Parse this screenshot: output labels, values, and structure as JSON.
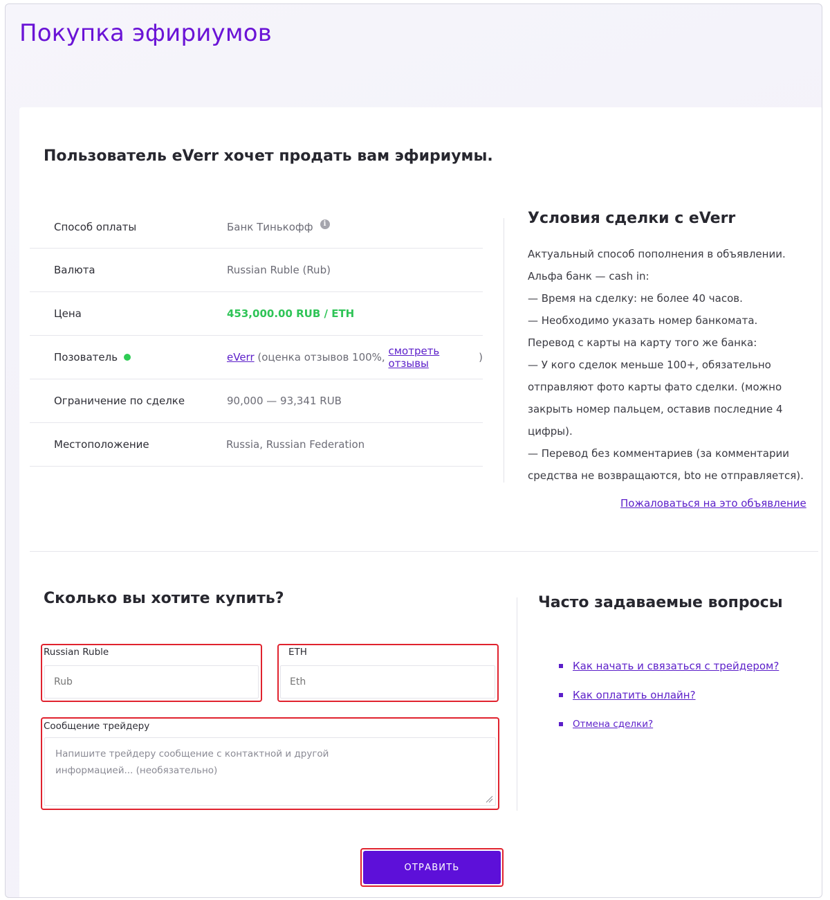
{
  "page_title": "Покупка эфириумов",
  "offer_heading": "Пользователь eVerr хочет продать вам эфириумы.",
  "details": {
    "payment_method_label": "Способ оплаты",
    "payment_method_value": "Банк Тинькофф",
    "currency_label": "Валюта",
    "currency_value": "Russian Ruble (Rub)",
    "price_label": "Цена",
    "price_value": "453,000.00 RUB / ETH",
    "user_label": "Позователь",
    "user_name": "eVerr",
    "user_rating_prefix": " (оценка отзывов 100%, ",
    "user_reviews_link": "смотреть отзывы",
    "user_rating_suffix": ")",
    "limit_label": "Ограничение по сделке",
    "limit_value": "90,000 — 93,341 RUB",
    "location_label": "Местоположение",
    "location_value": "Russia, Russian Federation"
  },
  "terms": {
    "heading": "Условия сделки с eVerr",
    "lines": [
      "Актуальный способ пополнения в объявлении.",
      "Альфа банк — cash in:",
      "— Время на сделку: не более 40 часов.",
      "— Необходимо указать номер банкомата.",
      "Перевод с карты на карту того же банка:",
      "— У кого сделок меньше 100+, обязательно отправляют фото карты фато сделки. (можно закрыть номер пальцем, оставив последние 4 цифры).",
      "— Перевод без комментариев (за комментарии средства не возвращаются, bto не отправляется)."
    ],
    "report_link": "Пожаловаться на это объявление"
  },
  "buy_form": {
    "heading": "Сколько вы хотите купить?",
    "rub_label": "Russian Ruble",
    "rub_placeholder": "Rub",
    "eth_label": "ETH",
    "eth_placeholder": "Eth",
    "message_label": "Сообщение трейдеру",
    "message_placeholder": "Напишите трейдеру сообщение с контактной и другой информацией... (необязательно)",
    "submit_label": "ОТРАВИТЬ"
  },
  "faq": {
    "heading": "Часто задаваемые вопросы",
    "items": [
      "Как начать и связаться с трейдером?",
      "Как оплатить онлайн?",
      "Отмена сделки?"
    ]
  },
  "colors": {
    "accent": "#6a13d6",
    "button": "#5d10d9",
    "price": "#2fc457",
    "online": "#2ecc54",
    "highlight_border": "#e0222e"
  }
}
